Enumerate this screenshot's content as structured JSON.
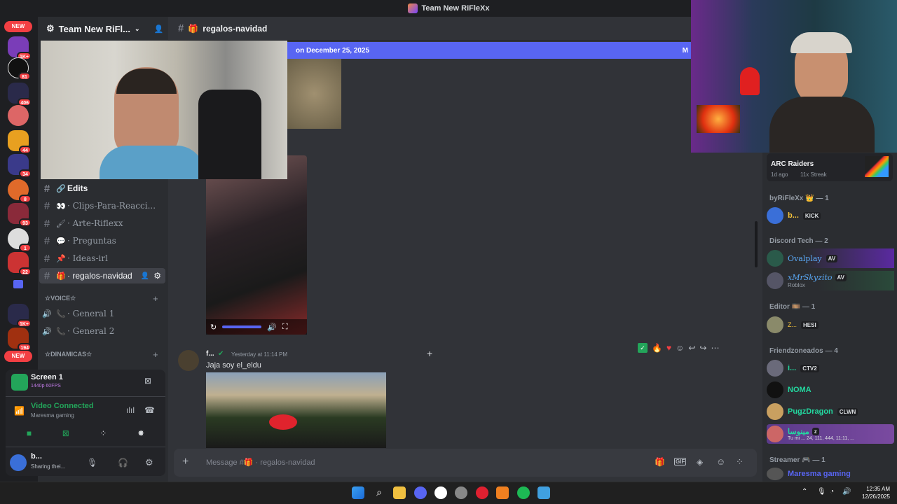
{
  "window": {
    "title": "Team New RiFleXx"
  },
  "rail": {
    "new_label": "NEW",
    "badges": [
      "1K+",
      "81",
      "406",
      "44",
      "34",
      "8",
      "93",
      "1",
      "22",
      "1K+",
      "194"
    ],
    "new_label_bottom": "NEW"
  },
  "guild": {
    "name": "Team New RiFl..."
  },
  "channels": {
    "edits": "Edits",
    "clips": "· Clips-Para-Reacci...",
    "arte": "· Arte-Riflexx",
    "preguntas": "· Preguntas",
    "ideas": "· Ideas-irl",
    "regalos": "· regalos-navidad",
    "voice_category": "☆VOICE☆",
    "general1": "· General 1",
    "general2": "· General 2",
    "dinamicas_category": "☆DINAMICAS☆"
  },
  "voice": {
    "stream_title": "Screen 1",
    "stream_quality": "1440p 60FPS",
    "status": "Video Connected",
    "server": "Maresma gaming",
    "user_name": "b...",
    "user_status": "Sharing thei..."
  },
  "chat": {
    "channel_name": "regalos-navidad",
    "banner_text": "on December 25, 2025",
    "banner_right": "M",
    "message_author": "f...",
    "message_time": "Yesterday at 11:14 PM",
    "message_text": "Jaja soy el_eldu",
    "input_placeholder": "Message #🎁 · regalos-navidad"
  },
  "activity": {
    "game": "ARC Raiders",
    "time": "1d ago",
    "streak": "11x Streak"
  },
  "members": {
    "group1": "byRiFleXx 👑 — 1",
    "m1_name": "b...",
    "m1_tag": "KICK",
    "group2": "Discord Tech — 2",
    "m2_name": "Ovalplay",
    "m2_tag": "AV",
    "m3_name": "xMrSkyzito",
    "m3_tag": "AV",
    "m3_sub": "Roblox",
    "group3": "Editor 🎞️ — 1",
    "m4_name": "Z...",
    "m4_tag": "HESI",
    "group4": "Friendzoneados — 4",
    "m5_name": "i...",
    "m5_tag": "CTV2",
    "m6_name": "NOMA",
    "m7_name": "PugzDragon",
    "m7_tag": "CLWN",
    "m8_name": "مینوسا",
    "m8_tag": "z",
    "m8_sub": "Tu mi ... 24, 111, 444, 11:11, ...",
    "group5": "Streamer 🎮 — 1",
    "m9_name": "Maresma gaming"
  },
  "clock": {
    "time": "12:35 AM",
    "date": "12/26/2025"
  },
  "colors": {
    "accent": "#5865f2",
    "online": "#23a55a",
    "danger": "#f23f43"
  }
}
